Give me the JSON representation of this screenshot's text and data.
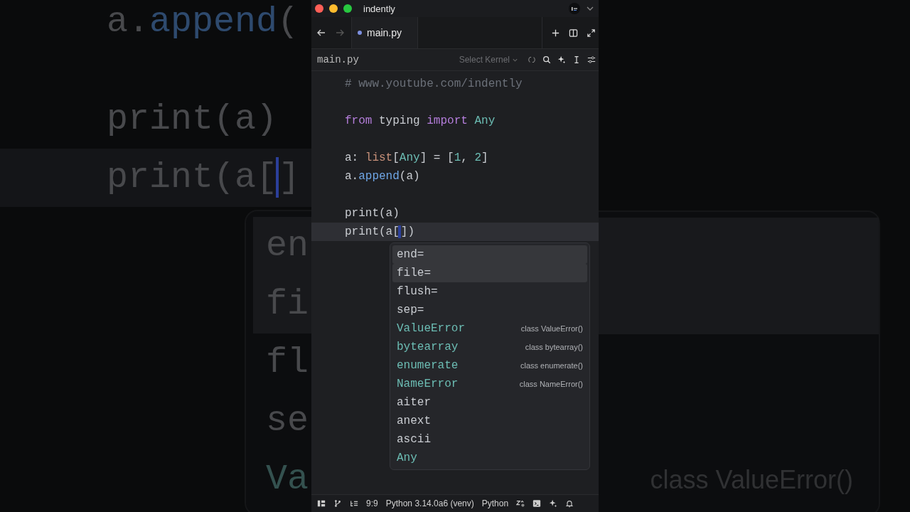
{
  "backdrop": {
    "code_lines": [
      {
        "kind": "code",
        "current": false,
        "tokens": [
          {
            "text": "a.",
            "kind": "plain"
          },
          {
            "text": "append",
            "kind": "function"
          },
          {
            "text": "(",
            "kind": "plain"
          }
        ]
      },
      {
        "kind": "blank"
      },
      {
        "kind": "code",
        "current": false,
        "tokens": [
          {
            "text": "print(a)",
            "kind": "plain"
          }
        ]
      },
      {
        "kind": "code",
        "current": true,
        "tokens": [
          {
            "text": "print(a[",
            "kind": "plain"
          },
          {
            "text": "]",
            "kind": "plain",
            "cursor_before": true
          }
        ]
      }
    ],
    "completions": [
      {
        "text": "en",
        "kind": "param",
        "selected": true
      },
      {
        "text": "fi",
        "kind": "param",
        "selected": true
      },
      {
        "text": "fl",
        "kind": "param",
        "selected": false
      },
      {
        "text": "se",
        "kind": "param",
        "selected": false
      },
      {
        "text": "Va",
        "kind": "class",
        "selected": false,
        "detail": "class ValueError()"
      }
    ]
  },
  "window": {
    "title": "indently"
  },
  "tabs": [
    {
      "label": "main.py",
      "selected": true,
      "modified": true
    }
  ],
  "breadcrumb": {
    "file": "main.py",
    "kernel": "Select Kernel"
  },
  "editor": {
    "lines": [
      {
        "kind": "code",
        "current": false,
        "tokens": [
          {
            "text": "# www.youtube.com/indently",
            "kind": "comment"
          }
        ]
      },
      {
        "kind": "blank"
      },
      {
        "kind": "code",
        "current": false,
        "tokens": [
          {
            "text": "from",
            "kind": "keyword"
          },
          {
            "text": " typing ",
            "kind": "plain"
          },
          {
            "text": "import",
            "kind": "keyword"
          },
          {
            "text": " Any",
            "kind": "type"
          }
        ]
      },
      {
        "kind": "blank"
      },
      {
        "kind": "code",
        "current": false,
        "tokens": [
          {
            "text": "a: ",
            "kind": "plain"
          },
          {
            "text": "list",
            "kind": "builtin"
          },
          {
            "text": "[",
            "kind": "plain"
          },
          {
            "text": "Any",
            "kind": "type"
          },
          {
            "text": "] = [",
            "kind": "plain"
          },
          {
            "text": "1",
            "kind": "number"
          },
          {
            "text": ", ",
            "kind": "plain"
          },
          {
            "text": "2",
            "kind": "number"
          },
          {
            "text": "]",
            "kind": "plain"
          }
        ]
      },
      {
        "kind": "code",
        "current": false,
        "tokens": [
          {
            "text": "a.",
            "kind": "plain"
          },
          {
            "text": "append",
            "kind": "function"
          },
          {
            "text": "(a)",
            "kind": "plain"
          }
        ]
      },
      {
        "kind": "blank"
      },
      {
        "kind": "code",
        "current": false,
        "tokens": [
          {
            "text": "print(a)",
            "kind": "plain"
          }
        ]
      },
      {
        "kind": "code",
        "current": true,
        "tokens": [
          {
            "text": "print(a[",
            "kind": "plain"
          },
          {
            "text": "])",
            "kind": "plain",
            "cursor_before": true
          }
        ]
      }
    ],
    "completions": [
      {
        "text": "end=",
        "kind": "param",
        "selected": true
      },
      {
        "text": "file=",
        "kind": "param",
        "selected": true
      },
      {
        "text": "flush=",
        "kind": "param",
        "selected": false
      },
      {
        "text": "sep=",
        "kind": "param",
        "selected": false
      },
      {
        "text": "ValueError",
        "kind": "class",
        "selected": false,
        "detail": "class ValueError()"
      },
      {
        "text": "bytearray",
        "kind": "class",
        "selected": false,
        "detail": "class bytearray()"
      },
      {
        "text": "enumerate",
        "kind": "class",
        "selected": false,
        "detail": "class enumerate()"
      },
      {
        "text": "NameError",
        "kind": "class",
        "selected": false,
        "detail": "class NameError()"
      },
      {
        "text": "aiter",
        "kind": "function",
        "selected": false
      },
      {
        "text": "anext",
        "kind": "function",
        "selected": false
      },
      {
        "text": "ascii",
        "kind": "function",
        "selected": false
      },
      {
        "text": "Any",
        "kind": "type",
        "selected": false
      }
    ]
  },
  "status_bar": {
    "position": "9:9",
    "interpreter": "Python 3.14.0a6 (venv)",
    "language": "Python"
  }
}
